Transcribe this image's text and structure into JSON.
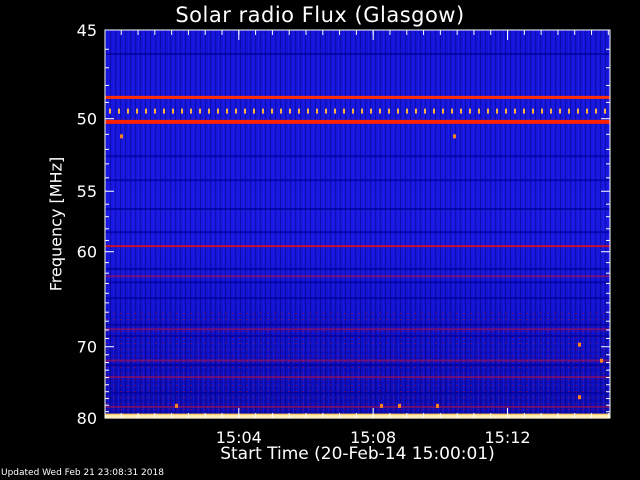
{
  "chart_data": {
    "type": "heatmap",
    "title": "Solar radio Flux (Glasgow)",
    "xlabel": "Start Time (20-Feb-14 15:00:01)",
    "ylabel": "Frequency [MHz]",
    "x_start": "15:00:01",
    "xlim": [
      "15:00:01",
      "15:15:03"
    ],
    "x_ticks": [
      "15:04",
      "15:08",
      "15:12"
    ],
    "y_scale": "reciprocal",
    "ylim": [
      45,
      80
    ],
    "y_ticks": [
      45,
      50,
      55,
      60,
      70,
      80
    ],
    "colormap": [
      "#000000",
      "#0000d0",
      "#d00000",
      "#ffa000",
      "#ffffff"
    ],
    "bright_bands_mhz": [
      48.7,
      50.2,
      59.5,
      79.7
    ],
    "grid": false,
    "legend": "none"
  },
  "footer": "Updated Wed Feb 21 23:08:31 2018"
}
